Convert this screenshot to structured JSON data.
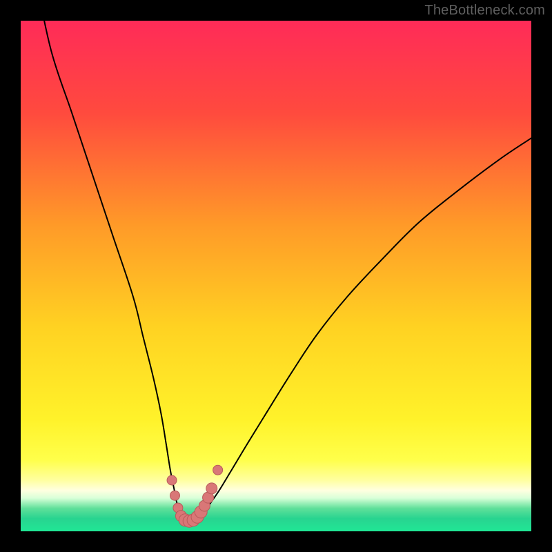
{
  "watermark": "TheBottleneck.com",
  "gradient": {
    "stops": [
      {
        "offset": 0,
        "color": "#ff2b58"
      },
      {
        "offset": 18,
        "color": "#ff4a3e"
      },
      {
        "offset": 40,
        "color": "#ff9a28"
      },
      {
        "offset": 60,
        "color": "#ffd222"
      },
      {
        "offset": 78,
        "color": "#fff22a"
      },
      {
        "offset": 86,
        "color": "#ffff4a"
      },
      {
        "offset": 90,
        "color": "#ffffa0"
      },
      {
        "offset": 92,
        "color": "#ffffe0"
      },
      {
        "offset": 93.5,
        "color": "#d8ffd8"
      },
      {
        "offset": 95.5,
        "color": "#60e09a"
      },
      {
        "offset": 97.5,
        "color": "#28d490"
      },
      {
        "offset": 100,
        "color": "#20e695"
      }
    ]
  },
  "chart_data": {
    "type": "line",
    "title": "",
    "xlabel": "",
    "ylabel": "",
    "xlim": [
      0,
      100
    ],
    "ylim": [
      0,
      100
    ],
    "series": [
      {
        "name": "bottleneck-curve",
        "x": [
          3,
          6,
          10,
          14,
          18,
          22,
          24,
          26,
          27.5,
          28.5,
          29.3,
          30,
          30.6,
          31.2,
          31.8,
          32.4,
          33.2,
          34,
          35,
          36.2,
          37.5,
          39,
          41,
          44,
          48,
          53,
          58,
          64,
          71,
          78,
          86,
          94,
          100
        ],
        "y": [
          108,
          94,
          82,
          70,
          58,
          46,
          38,
          30,
          23,
          17,
          12,
          8.5,
          5.5,
          3.5,
          2.4,
          2.0,
          2.0,
          2.3,
          3.0,
          4.2,
          6.0,
          8.2,
          11.5,
          16.5,
          23,
          31,
          38.5,
          46,
          53.5,
          60.5,
          67,
          73,
          77
        ]
      }
    ],
    "scatter": {
      "name": "markers",
      "points": [
        {
          "x": 29.6,
          "y": 10.0,
          "r": 7
        },
        {
          "x": 30.2,
          "y": 7.0,
          "r": 7
        },
        {
          "x": 30.8,
          "y": 4.6,
          "r": 7
        },
        {
          "x": 31.4,
          "y": 3.0,
          "r": 8
        },
        {
          "x": 32.2,
          "y": 2.2,
          "r": 9
        },
        {
          "x": 33.0,
          "y": 2.0,
          "r": 9
        },
        {
          "x": 33.8,
          "y": 2.2,
          "r": 9
        },
        {
          "x": 34.6,
          "y": 2.8,
          "r": 9
        },
        {
          "x": 35.3,
          "y": 3.8,
          "r": 9
        },
        {
          "x": 36.0,
          "y": 5.0,
          "r": 8
        },
        {
          "x": 36.7,
          "y": 6.6,
          "r": 8
        },
        {
          "x": 37.4,
          "y": 8.4,
          "r": 8
        },
        {
          "x": 38.6,
          "y": 12.0,
          "r": 7
        }
      ]
    }
  }
}
